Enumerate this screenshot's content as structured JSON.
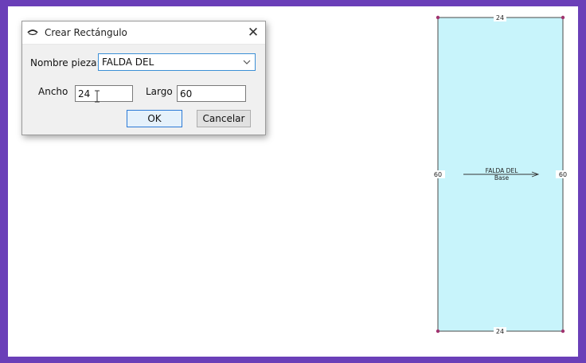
{
  "dialog": {
    "title": "Crear Rectángulo",
    "close_glyph": "✕",
    "piece_name_label": "Nombre pieza:",
    "piece_name_value": "FALDA DEL",
    "width_label": "Ancho",
    "width_value": "24",
    "length_label": "Largo",
    "length_value": "60",
    "ok_label": "OK",
    "cancel_label": "Cancelar"
  },
  "piece": {
    "fill_color": "#c8f4fb",
    "outline_color": "#4a4a4a",
    "vertex_color": "#a0336e",
    "top_dim": "24",
    "bottom_dim": "24",
    "left_dim": "60",
    "right_dim": "60",
    "name": "FALDA DEL",
    "size_label": "Base"
  },
  "icons": {
    "title": "eye-icon",
    "dropdown": "chevron-down-icon",
    "text_cursor": "ibeam-cursor-icon",
    "grainline": "grainline-arrow-icon"
  }
}
